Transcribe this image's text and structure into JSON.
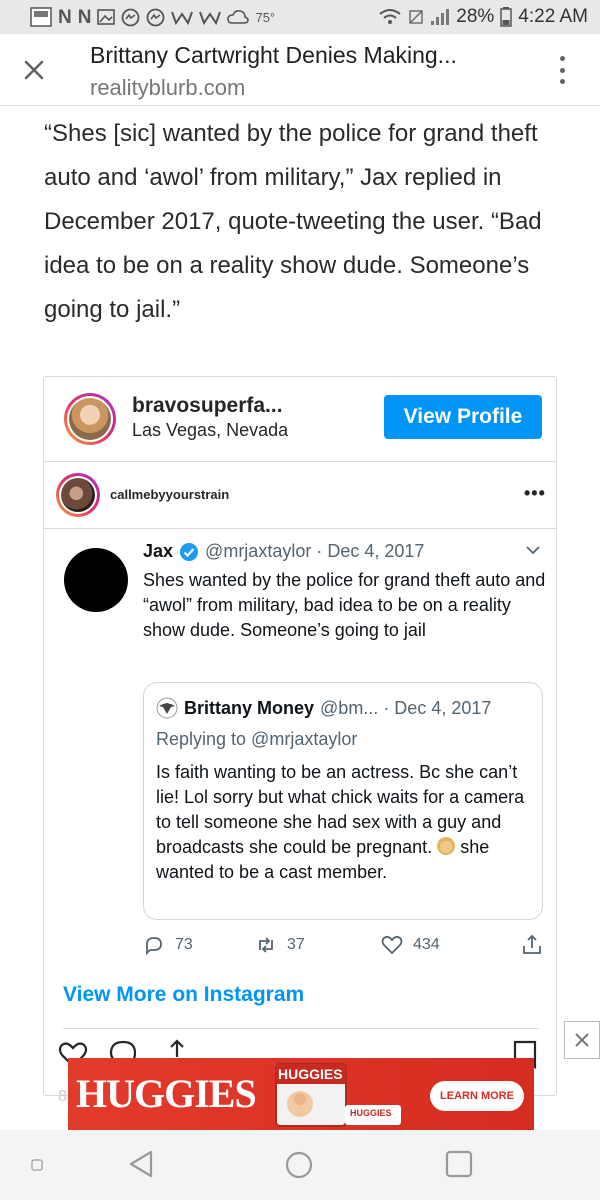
{
  "status_bar": {
    "left_icons": [
      "notification-app-icon",
      "n-icon",
      "n-icon",
      "image-icon",
      "messenger-icon",
      "messenger-icon",
      "w-icon",
      "w-icon",
      "cloud-icon"
    ],
    "temperature": "75°",
    "battery": "28%",
    "time": "4:22 AM"
  },
  "toolbar": {
    "title": "Brittany Cartwright Denies Making...",
    "url": "realityblurb.com"
  },
  "article": {
    "paragraph": "“Shes [sic] wanted by the police for grand theft auto and ‘awol’ from military,” Jax replied in December 2017, quote-tweeting the user. “Bad idea to be on a reality show dude. Someone’s going to jail.”"
  },
  "instagram": {
    "username": "bravosuperfa...",
    "location": "Las Vegas, Nevada",
    "view_profile": "View Profile",
    "post_username": "callmebyyourstrain",
    "more": "•••",
    "view_more": "View More on Instagram"
  },
  "tweet": {
    "name": "Jax",
    "handle_date": "@mrjaxtaylor · Dec 4, 2017",
    "body": "Shes wanted by the police for grand theft auto and “awol” from military, bad idea to be on a reality show dude. Someone’s going to jail",
    "quote": {
      "name": "Brittany Money",
      "handle_date": "@bm... · Dec 4, 2017",
      "replying": "Replying to @mrjaxtaylor",
      "text_before_emoji": "Is faith wanting to be an actress. Bc she can’t lie! Lol sorry but what chick waits for a camera to tell someone she had sex with a guy and broadcasts she could be pregnant.",
      "text_after_emoji": "she wanted to be a cast member."
    },
    "replies": "73",
    "retweets": "37",
    "likes": "434"
  },
  "ad": {
    "brand": "HUGGIES",
    "pack_label": "HUGGIES",
    "wipes_label": "HUGGIES",
    "cta": "LEARN MORE",
    "close": "✕"
  },
  "hidden_count_digit": "8"
}
